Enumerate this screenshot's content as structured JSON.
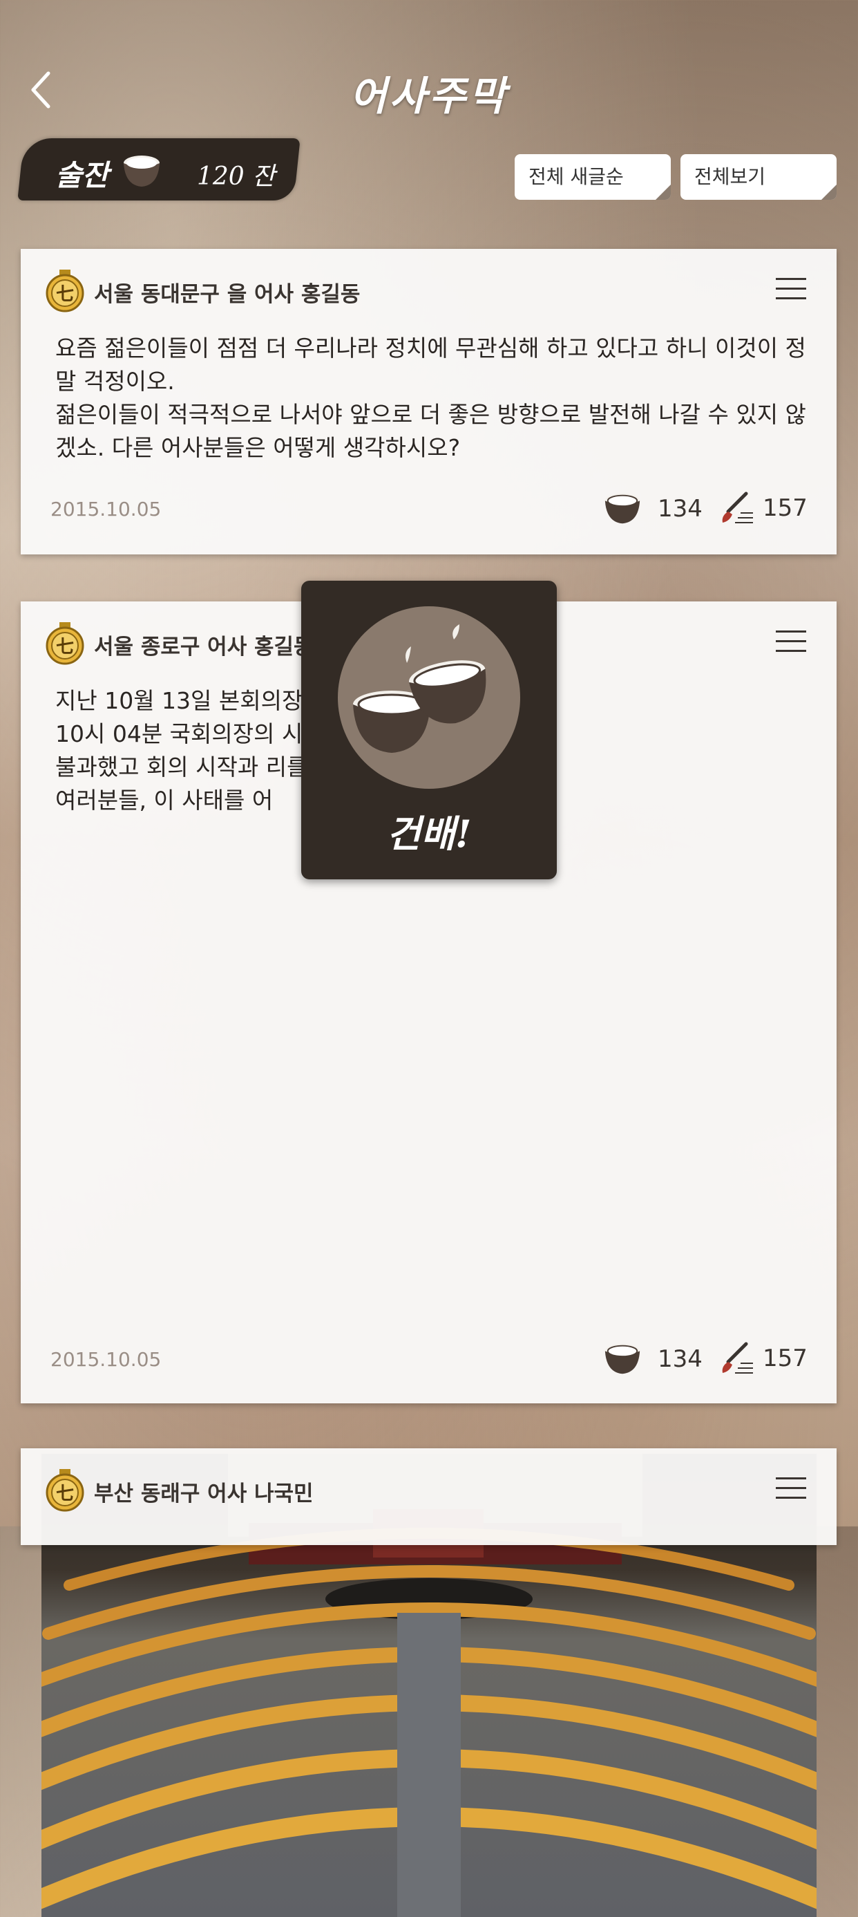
{
  "header": {
    "title": "어사주막",
    "back_icon": "chevron-left-icon"
  },
  "drink_badge": {
    "label": "술잔",
    "count": "120 잔"
  },
  "filters": {
    "sort": "전체 새글순",
    "view": "전체보기"
  },
  "posts": [
    {
      "author": "서울 동대문구 을 어사 홍길동",
      "medal": "七",
      "text": "요즘 젊은이들이 점점 더 우리나라 정치에 무관심해 하고 있다고 하니 이것이 정말 걱정이오.\n젊은이들이 적극적으로 나서야 앞으로 더 좋은 방향으로 발전해 나갈 수 있지 않겠소. 다른 어사분들은 어떻게 생각하시오?",
      "date": "2015.10.05",
      "cheers": "134",
      "comments": "157"
    },
    {
      "author": "서울 종로구 어사 홍길동",
      "medal": "七",
      "text_lines": [
        "지난 10월 13일 본회의장 268명..",
        "10시 04분 국회의장의 시 출석 의원이 119명에",
        "불과했고 회의 시작과 리를 떴다는 소식이오.",
        "여러분들, 이 사태를 어"
      ],
      "date": "2015.10.05",
      "cheers": "134",
      "comments": "157"
    },
    {
      "author": "부산 동래구 어사 나국민",
      "medal": "七"
    }
  ],
  "toast": {
    "text": "건배!"
  },
  "colors": {
    "dark": "#332b25",
    "accent_gold": "#e8b53a",
    "text": "#3a3430"
  }
}
